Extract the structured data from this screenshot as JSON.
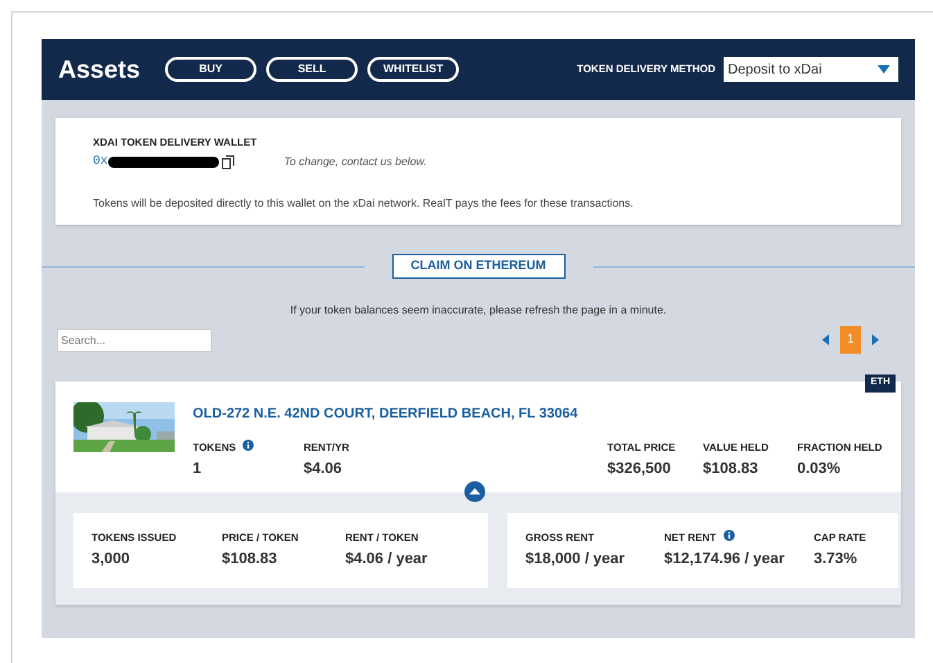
{
  "header": {
    "title": "Assets",
    "buttons": [
      "BUY",
      "SELL",
      "WHITELIST"
    ],
    "delivery_label": "TOKEN DELIVERY METHOD",
    "delivery_value": "Deposit to xDai"
  },
  "wallet": {
    "label": "XDAI TOKEN DELIVERY WALLET",
    "address": "0x",
    "hint": "To change, contact us below.",
    "note": "Tokens will be deposited directly to this wallet on the xDai network. RealT pays the fees for these transactions."
  },
  "claim_button": "CLAIM ON ETHEREUM",
  "refresh_note": "If your token balances seem inaccurate, please refresh the page in a minute.",
  "search": {
    "placeholder": "Search..."
  },
  "pages": [
    {
      "label": "1",
      "selected": true
    }
  ],
  "asset": {
    "badge": "ETH",
    "title": "OLD-272 N.E. 42ND COURT, DEERFIELD BEACH, FL 33064",
    "expanded": true,
    "stats_left": [
      {
        "label": "TOKENS",
        "value": "1",
        "info": true
      },
      {
        "label": "RENT/YR",
        "value": "$4.06",
        "info": false
      }
    ],
    "stats_right": [
      {
        "label": "TOTAL PRICE",
        "value": "$326,500",
        "info": false
      },
      {
        "label": "VALUE HELD",
        "value": "$108.83",
        "info": false
      },
      {
        "label": "FRACTION HELD",
        "value": "0.03%",
        "info": false
      }
    ],
    "details": [
      [
        {
          "label": "TOKENS ISSUED",
          "value": "3,000",
          "info": false
        },
        {
          "label": "PRICE / TOKEN",
          "value": "$108.83",
          "info": false
        },
        {
          "label": "RENT / TOKEN",
          "value": "$4.06 / year",
          "info": false
        }
      ],
      [
        {
          "label": "GROSS RENT",
          "value": "$18,000 / year",
          "info": false
        },
        {
          "label": "NET RENT",
          "value": "$12,174.96 / year",
          "info": true
        },
        {
          "label": "CAP RATE",
          "value": "3.73%",
          "info": false
        }
      ]
    ]
  }
}
